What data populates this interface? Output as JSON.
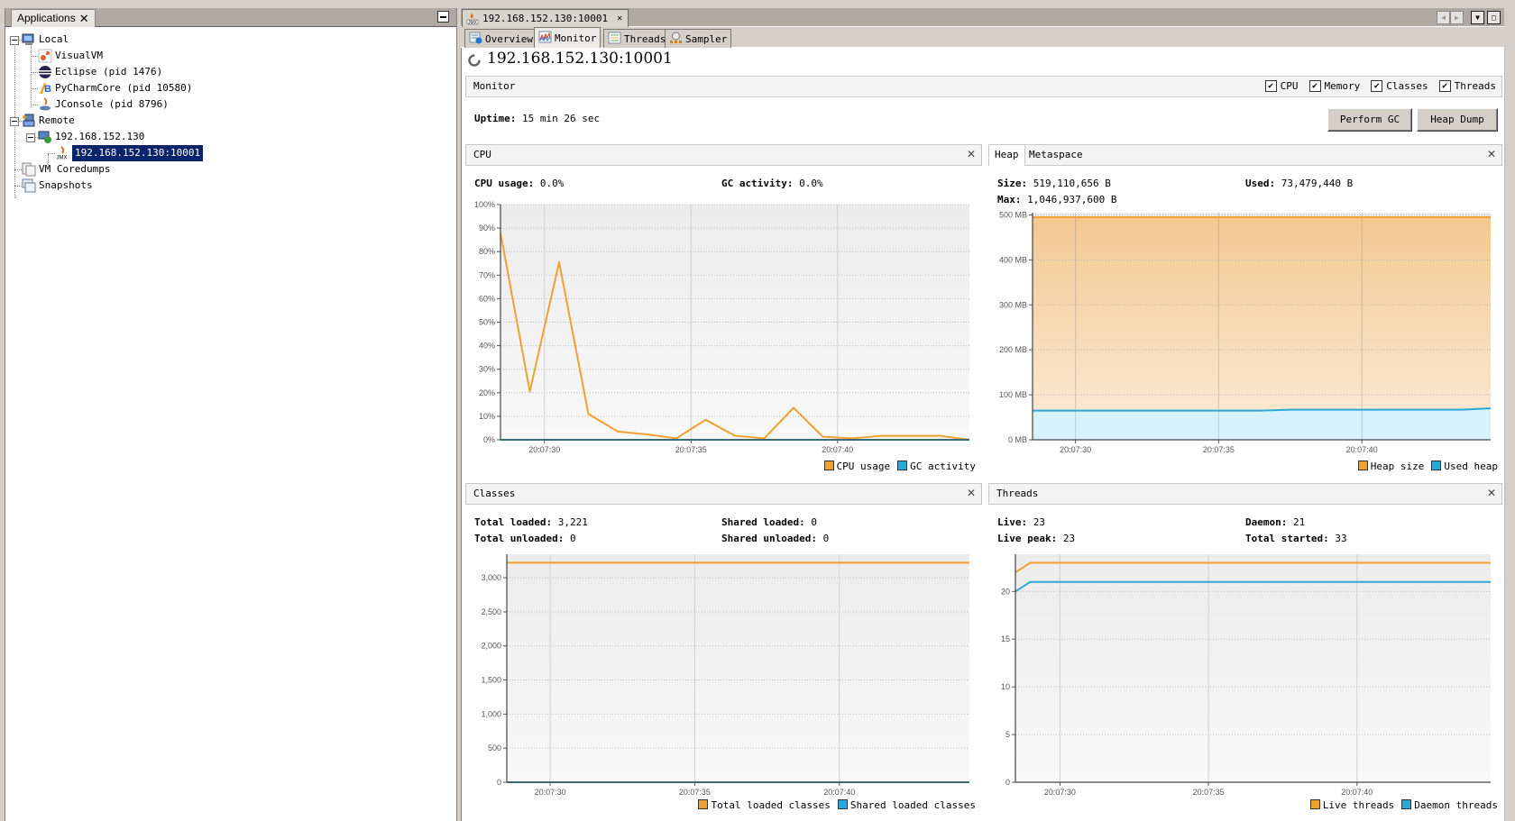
{
  "left_panel": {
    "tab_label": "Applications",
    "tree": [
      {
        "label": "Local",
        "icon": "local-host-icon",
        "level": 0
      },
      {
        "label": "VisualVM",
        "icon": "visualvm-icon",
        "level": 1
      },
      {
        "label": "Eclipse (pid 1476)",
        "icon": "eclipse-icon",
        "level": 1
      },
      {
        "label": "PyCharmCore (pid 10580)",
        "icon": "pycharm-icon",
        "level": 1
      },
      {
        "label": "JConsole (pid 8796)",
        "icon": "java-icon",
        "level": 1
      },
      {
        "label": "Remote",
        "icon": "remote-hosts-icon",
        "level": 0
      },
      {
        "label": "192.168.152.130",
        "icon": "remote-host-icon",
        "level": 1
      },
      {
        "label": "192.168.152.130:10001",
        "icon": "jmx-icon",
        "level": 2,
        "selected": true
      },
      {
        "label": "VM Coredumps",
        "icon": "coredumps-icon",
        "level": 0
      },
      {
        "label": "Snapshots",
        "icon": "snapshots-icon",
        "level": 0
      }
    ]
  },
  "document": {
    "tab_label": "192.168.152.130:10001",
    "subtabs": [
      {
        "label": "Overview",
        "icon": "overview-icon"
      },
      {
        "label": "Monitor",
        "icon": "monitor-icon",
        "active": true
      },
      {
        "label": "Threads",
        "icon": "threads-icon"
      },
      {
        "label": "Sampler",
        "icon": "sampler-icon"
      }
    ],
    "title": "192.168.152.130:10001",
    "section_label": "Monitor",
    "checkboxes": [
      {
        "label": "CPU",
        "checked": true
      },
      {
        "label": "Memory",
        "checked": true
      },
      {
        "label": "Classes",
        "checked": true
      },
      {
        "label": "Threads",
        "checked": true
      }
    ],
    "uptime_label": "Uptime:",
    "uptime_value": "15 min 26 sec",
    "perform_gc_label": "Perform GC",
    "heap_dump_label": "Heap Dump"
  },
  "colors": {
    "orange": "#f0a030",
    "blue": "#2aa8d8",
    "selection": "#0a246a"
  },
  "panels": {
    "cpu": {
      "title": "CPU",
      "stats": [
        {
          "label": "CPU usage:",
          "value": "0.0%"
        },
        {
          "label": "GC activity:",
          "value": "0.0%"
        }
      ],
      "legend": [
        "CPU usage",
        "GC activity"
      ]
    },
    "heap": {
      "tabs": [
        "Heap",
        "Metaspace"
      ],
      "stats": [
        {
          "label": "Size:",
          "value": "519,110,656 B"
        },
        {
          "label": "Used:",
          "value": "73,479,440 B"
        },
        {
          "label": "Max:",
          "value": "1,046,937,600 B"
        }
      ],
      "legend": [
        "Heap size",
        "Used heap"
      ]
    },
    "classes": {
      "title": "Classes",
      "stats": [
        {
          "label": "Total loaded:",
          "value": "3,221"
        },
        {
          "label": "Shared loaded:",
          "value": "0"
        },
        {
          "label": "Total unloaded:",
          "value": "0"
        },
        {
          "label": "Shared unloaded:",
          "value": "0"
        }
      ],
      "legend": [
        "Total loaded classes",
        "Shared loaded classes"
      ]
    },
    "threads": {
      "title": "Threads",
      "stats": [
        {
          "label": "Live:",
          "value": "23"
        },
        {
          "label": "Daemon:",
          "value": "21"
        },
        {
          "label": "Live peak:",
          "value": "23"
        },
        {
          "label": "Total started:",
          "value": "33"
        }
      ],
      "legend": [
        "Live threads",
        "Daemon threads"
      ]
    }
  },
  "chart_data": [
    {
      "id": "cpu",
      "type": "line",
      "title": "CPU",
      "x_unit": "seconds after 20:07:00",
      "x": [
        28.5,
        29.5,
        30.5,
        31.5,
        32.5,
        33.5,
        34.5,
        35.5,
        36.5,
        37.5,
        38.5,
        39.5,
        40.5,
        41.5,
        42.5,
        43.5,
        44.5
      ],
      "xlim": [
        28.5,
        44.5
      ],
      "xticks": [
        {
          "v": 30,
          "label": "20:07:30"
        },
        {
          "v": 35,
          "label": "20:07:35"
        },
        {
          "v": 40,
          "label": "20:07:40"
        }
      ],
      "ylim": [
        0,
        100
      ],
      "yticks": [
        {
          "v": 0,
          "label": "0%"
        },
        {
          "v": 10,
          "label": "10%"
        },
        {
          "v": 20,
          "label": "20%"
        },
        {
          "v": 30,
          "label": "30%"
        },
        {
          "v": 40,
          "label": "40%"
        },
        {
          "v": 50,
          "label": "50%"
        },
        {
          "v": 60,
          "label": "60%"
        },
        {
          "v": 70,
          "label": "70%"
        },
        {
          "v": 80,
          "label": "80%"
        },
        {
          "v": 90,
          "label": "90%"
        },
        {
          "v": 100,
          "label": "100%"
        }
      ],
      "series": [
        {
          "name": "CPU usage",
          "color": "#f0a030",
          "values": [
            88,
            20.5,
            75.5,
            11,
            3.5,
            2.3,
            0.6,
            8.5,
            1.7,
            0.6,
            13.6,
            1.3,
            0.6,
            1.7,
            1.7,
            1.7,
            0
          ]
        },
        {
          "name": "GC activity",
          "color": "#2aa8d8",
          "values": [
            0,
            0,
            0,
            0,
            0,
            0,
            0,
            0,
            0,
            0,
            0,
            0,
            0,
            0,
            0,
            0,
            0
          ]
        }
      ]
    },
    {
      "id": "heap",
      "type": "area",
      "title": "Heap",
      "x_unit": "seconds after 20:07:00",
      "x": [
        28.5,
        32.5,
        36.5,
        37.5,
        40.5,
        43.5,
        44.5
      ],
      "xlim": [
        28.5,
        44.5
      ],
      "xticks": [
        {
          "v": 30,
          "label": "20:07:30"
        },
        {
          "v": 35,
          "label": "20:07:35"
        },
        {
          "v": 40,
          "label": "20:07:40"
        }
      ],
      "ylim": [
        0,
        505
      ],
      "yticks": [
        {
          "v": 0,
          "label": "0 MB"
        },
        {
          "v": 100,
          "label": "100 MB"
        },
        {
          "v": 200,
          "label": "200 MB"
        },
        {
          "v": 300,
          "label": "300 MB"
        },
        {
          "v": 400,
          "label": "400 MB"
        },
        {
          "v": 500,
          "label": "500 MB"
        }
      ],
      "series": [
        {
          "name": "Heap size",
          "color": "#f0a030",
          "values": [
            495,
            495,
            495,
            495,
            495,
            495,
            495
          ]
        },
        {
          "name": "Used heap",
          "color": "#2aa8d8",
          "values": [
            65,
            65,
            65,
            67,
            67,
            67,
            70
          ]
        }
      ]
    },
    {
      "id": "classes",
      "type": "line",
      "title": "Classes",
      "x_unit": "seconds after 20:07:00",
      "x": [
        28.5,
        44.5
      ],
      "xlim": [
        28.5,
        44.5
      ],
      "xticks": [
        {
          "v": 30,
          "label": "20:07:30"
        },
        {
          "v": 35,
          "label": "20:07:35"
        },
        {
          "v": 40,
          "label": "20:07:40"
        }
      ],
      "ylim": [
        0,
        3345
      ],
      "yticks": [
        {
          "v": 0,
          "label": "0"
        },
        {
          "v": 500,
          "label": "500"
        },
        {
          "v": 1000,
          "label": "1,000"
        },
        {
          "v": 1500,
          "label": "1,500"
        },
        {
          "v": 2000,
          "label": "2,000"
        },
        {
          "v": 2500,
          "label": "2,500"
        },
        {
          "v": 3000,
          "label": "3,000"
        }
      ],
      "series": [
        {
          "name": "Total loaded classes",
          "color": "#f0a030",
          "values": [
            3221,
            3221
          ]
        },
        {
          "name": "Shared loaded classes",
          "color": "#2aa8d8",
          "values": [
            0,
            0
          ]
        }
      ]
    },
    {
      "id": "threads",
      "type": "line",
      "title": "Threads",
      "x_unit": "seconds after 20:07:00",
      "x": [
        28.5,
        29.0,
        44.5
      ],
      "xlim": [
        28.5,
        44.5
      ],
      "xticks": [
        {
          "v": 30,
          "label": "20:07:30"
        },
        {
          "v": 35,
          "label": "20:07:35"
        },
        {
          "v": 40,
          "label": "20:07:40"
        }
      ],
      "ylim": [
        0,
        23.9
      ],
      "yticks": [
        {
          "v": 0,
          "label": "0"
        },
        {
          "v": 5,
          "label": "5"
        },
        {
          "v": 10,
          "label": "10"
        },
        {
          "v": 15,
          "label": "15"
        },
        {
          "v": 20,
          "label": "20"
        }
      ],
      "series": [
        {
          "name": "Live threads",
          "color": "#f0a030",
          "values": [
            22,
            23,
            23
          ]
        },
        {
          "name": "Daemon threads",
          "color": "#2aa8d8",
          "values": [
            20,
            21,
            21
          ]
        }
      ]
    }
  ]
}
